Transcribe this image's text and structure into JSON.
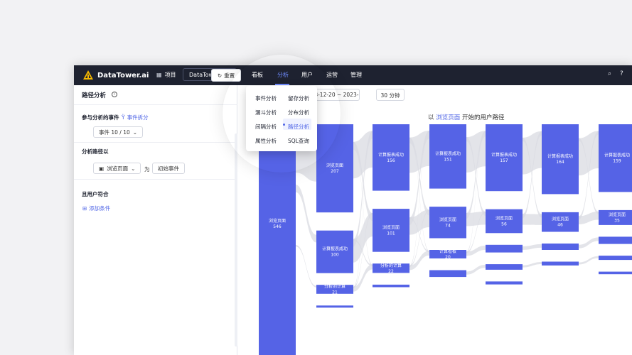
{
  "brand": {
    "name": "DataTower.ai"
  },
  "topnav": {
    "project_label": "项目",
    "project_value": "DataTower.ai",
    "items": [
      "看板",
      "分析",
      "用户",
      "运营",
      "管理"
    ],
    "active_index": 1
  },
  "sidebar": {
    "title": "路径分析",
    "reset_label": "重置",
    "events_section": "参与分析的事件",
    "split_link": "事件拆分",
    "event_chip": "事件  10 / 10",
    "path_section": "分析路径以",
    "path_chip": "浏览页面",
    "as_text": "为",
    "start_chip": "初始事件",
    "user_section": "且用户符合",
    "add_condition": "添加条件"
  },
  "toolbar": {
    "date_range": "2023-12-20 ~ 2023-12-26",
    "duration": "30 分钟"
  },
  "chart_header": {
    "prefix": "以",
    "highlight": "浏览页面",
    "suffix": "开始的用户路径"
  },
  "dropdown": {
    "items_col1": [
      "事件分析",
      "漏斗分析",
      "间隔分析",
      "属性分析"
    ],
    "items_col2": [
      "留存分析",
      "分布分析",
      "路径分析",
      "SQL查询"
    ],
    "active": "路径分析"
  },
  "colors": {
    "accent": "#4d63e6",
    "node": "#5563e6",
    "flow": "#d9dbe1",
    "topbar": "#1e2230"
  },
  "chart_data": {
    "type": "sankey",
    "title": "以 浏览页面 开始的用户路径",
    "columns": [
      {
        "step": 1,
        "nodes": [
          {
            "name": "浏览页面",
            "value": 546
          }
        ]
      },
      {
        "step": 2,
        "nodes": [
          {
            "name": "浏览页面",
            "value": 207
          },
          {
            "name": "计算报表成功",
            "value": 100
          },
          {
            "name": "分析的计算",
            "value": 21
          },
          {
            "name": "分析的计算",
            "value": null
          }
        ]
      },
      {
        "step": 3,
        "nodes": [
          {
            "name": "计算报表成功",
            "value": 156
          },
          {
            "name": "浏览页面",
            "value": 101
          },
          {
            "name": "分析的计算",
            "value": 22
          },
          {
            "name": "分析的计算",
            "value": 6
          }
        ]
      },
      {
        "step": 4,
        "nodes": [
          {
            "name": "计算报表成功",
            "value": 151
          },
          {
            "name": "浏览页面",
            "value": 74
          },
          {
            "name": "计算看板",
            "value": 20
          },
          {
            "name": "分析的计算",
            "value": 16
          }
        ]
      },
      {
        "step": 5,
        "nodes": [
          {
            "name": "计算报表成功",
            "value": 157
          },
          {
            "name": "浏览页面",
            "value": 56
          },
          {
            "name": "分析的计算",
            "value": 18
          },
          {
            "name": "计算看板",
            "value": 13
          },
          {
            "name": "Item",
            "value": 7
          }
        ]
      },
      {
        "step": 6,
        "nodes": [
          {
            "name": "计算报表成功",
            "value": 164
          },
          {
            "name": "浏览页面",
            "value": 46
          },
          {
            "name": "分析的计算",
            "value": 15
          },
          {
            "name": "计算看板",
            "value": 9
          }
        ]
      },
      {
        "step": 7,
        "nodes": [
          {
            "name": "计算报表成功",
            "value": 159
          },
          {
            "name": "浏览页面",
            "value": 35
          },
          {
            "name": "分析的计算",
            "value": 17
          },
          {
            "name": "计算看板",
            "value": 10
          },
          {
            "name": "Item",
            "value": 6
          }
        ]
      }
    ]
  }
}
